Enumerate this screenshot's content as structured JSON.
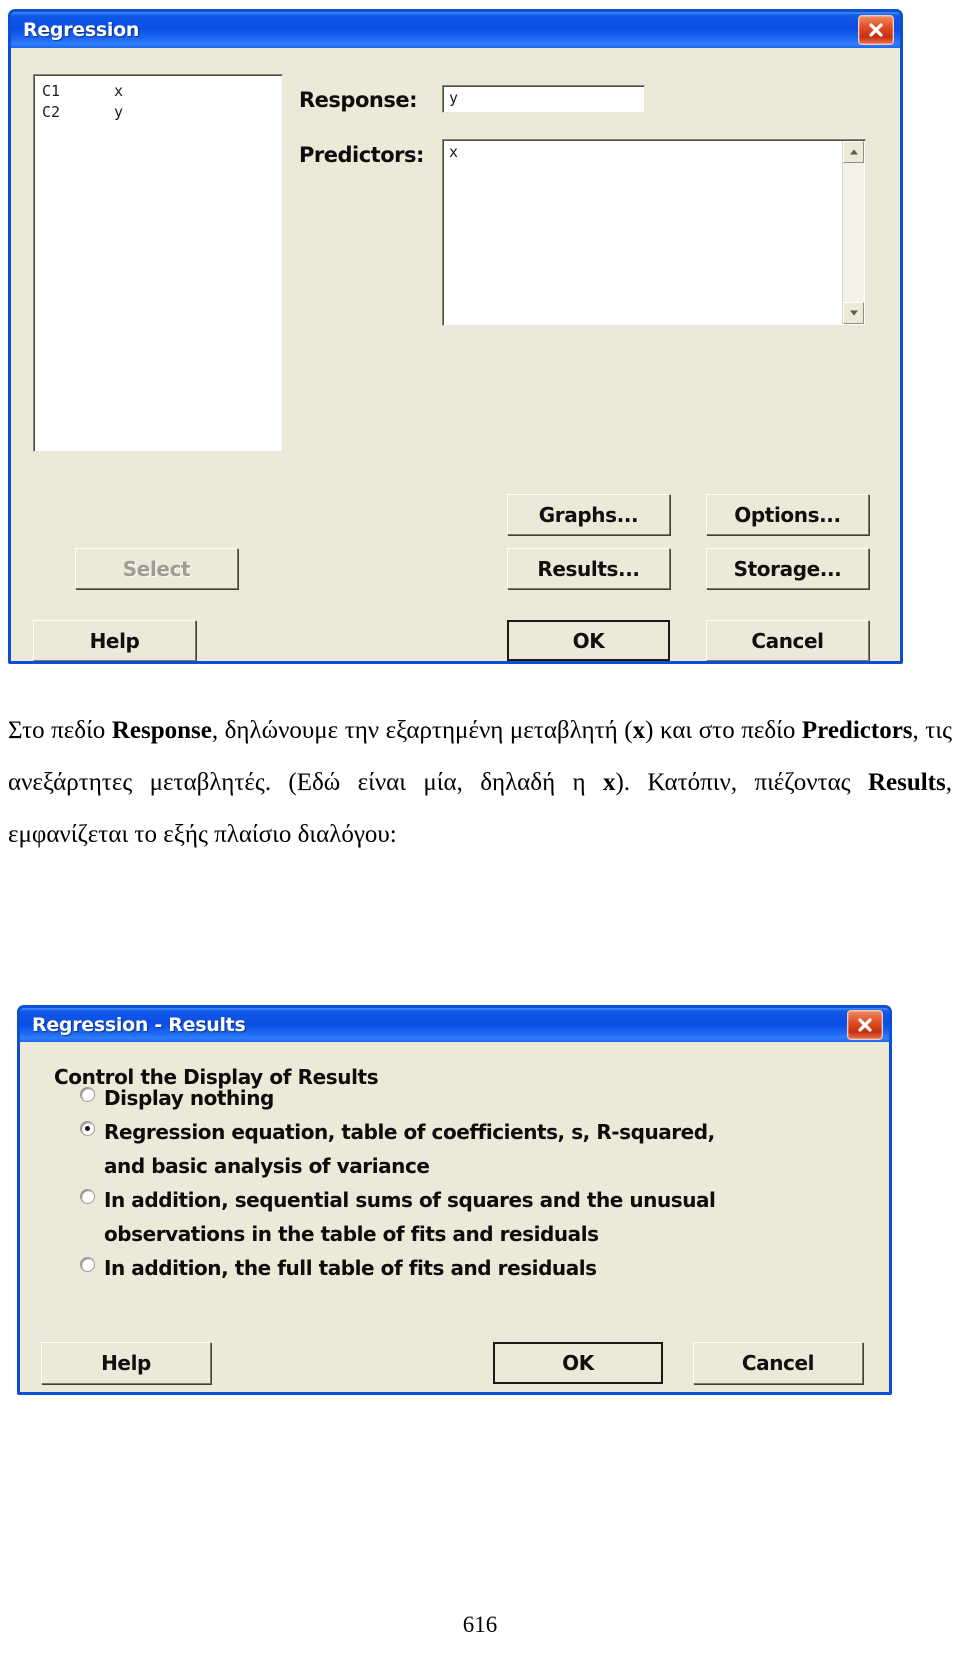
{
  "colors": {
    "title_bar_blue": "#0b4ee4",
    "dialog_face": "#ece9d8",
    "close_red": "#c62f10",
    "disabled_text": "#9d9d93"
  },
  "regression_dialog": {
    "title": "Regression",
    "close_button": "x",
    "variable_list": [
      {
        "column": "C1",
        "name": "x"
      },
      {
        "column": "C2",
        "name": "y"
      }
    ],
    "response_label": "Response:",
    "response_value": "y",
    "predictors_label": "Predictors:",
    "predictors_value": "x",
    "buttons": {
      "graphs": "Graphs...",
      "options": "Options...",
      "results": "Results...",
      "storage": "Storage...",
      "select": "Select",
      "help": "Help",
      "ok": "OK",
      "cancel": "Cancel"
    }
  },
  "paragraph": {
    "segments": [
      {
        "text": "Στο πεδίο ",
        "bold": false
      },
      {
        "text": "Response",
        "bold": true
      },
      {
        "text": ", δηλώνουμε την εξαρτημένη μεταβλητή (",
        "bold": false
      },
      {
        "text": "x",
        "bold": true
      },
      {
        "text": ") και στο πεδίο ",
        "bold": false
      },
      {
        "text": "Predictors",
        "bold": true
      },
      {
        "text": ", τις ανεξάρτητες μεταβλητές. (Εδώ είναι μία, δηλαδή η ",
        "bold": false
      },
      {
        "text": "x",
        "bold": true
      },
      {
        "text": "). Κατόπιν, πιέζοντας ",
        "bold": false
      },
      {
        "text": "Results",
        "bold": true
      },
      {
        "text": ", εμφανίζεται το εξής πλαίσιο διαλόγου:",
        "bold": false
      }
    ]
  },
  "results_dialog": {
    "title": "Regression - Results",
    "close_button": "x",
    "group_label": "Control the Display of Results",
    "options": [
      {
        "line1": "Display nothing",
        "line2": "",
        "selected": false
      },
      {
        "line1": "Regression equation, table of coefficients, s, R-squared,",
        "line2": "and basic analysis of variance",
        "selected": true
      },
      {
        "line1": "In addition, sequential sums of squares and the unusual",
        "line2": "observations in the table of fits and residuals",
        "selected": false
      },
      {
        "line1": "In addition, the full table of fits and residuals",
        "line2": "",
        "selected": false
      }
    ],
    "buttons": {
      "help": "Help",
      "ok": "OK",
      "cancel": "Cancel"
    }
  },
  "page": {
    "number": "616"
  }
}
